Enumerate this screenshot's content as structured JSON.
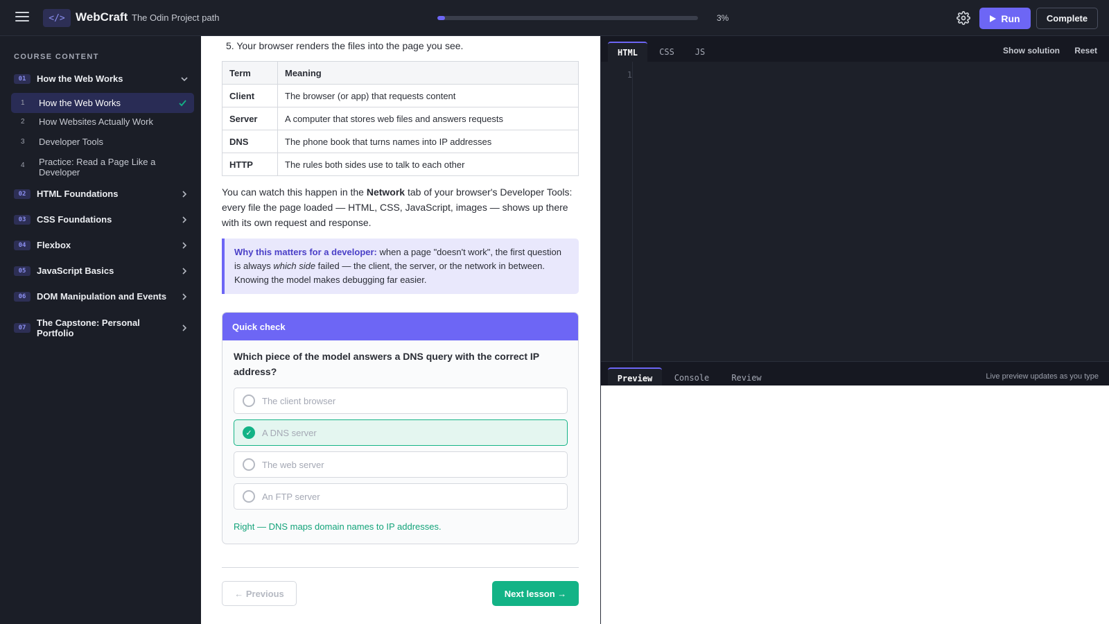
{
  "header": {
    "logo_glyph": "</>",
    "brand": "WebCraft",
    "subtitle": "The Odin Project path",
    "progress_percent": 3,
    "progress_label": "3%",
    "run_label": "Run",
    "complete_label": "Complete"
  },
  "sidebar": {
    "heading": "COURSE CONTENT",
    "modules": [
      {
        "num": "01",
        "title": "How the Web Works",
        "expanded": true
      },
      {
        "num": "02",
        "title": "HTML Foundations",
        "expanded": false
      },
      {
        "num": "03",
        "title": "CSS Foundations",
        "expanded": false
      },
      {
        "num": "04",
        "title": "Flexbox",
        "expanded": false
      },
      {
        "num": "05",
        "title": "JavaScript Basics",
        "expanded": false
      },
      {
        "num": "06",
        "title": "DOM Manipulation and Events",
        "expanded": false
      },
      {
        "num": "07",
        "title": "The Capstone: Personal Portfolio",
        "expanded": false
      }
    ],
    "lessons": [
      {
        "num": "1",
        "title": "How the Web Works",
        "active": true,
        "done": true
      },
      {
        "num": "2",
        "title": "How Websites Actually Work",
        "active": false,
        "done": false
      },
      {
        "num": "3",
        "title": "Developer Tools",
        "active": false,
        "done": false
      },
      {
        "num": "4",
        "title": "Practice: Read a Page Like a Developer",
        "active": false,
        "done": false
      }
    ]
  },
  "lesson": {
    "step5": "5. Your browser renders the files into the page you see.",
    "table": {
      "headers": [
        "Term",
        "Meaning"
      ],
      "rows": [
        [
          "Client",
          "The browser (or app) that requests content"
        ],
        [
          "Server",
          "A computer that stores web files and answers requests"
        ],
        [
          "DNS",
          "The phone book that turns names into IP addresses"
        ],
        [
          "HTTP",
          "The rules both sides use to talk to each other"
        ]
      ]
    },
    "para_pre": "You can watch this happen in the ",
    "para_bold": "Network",
    "para_post": " tab of your browser's Developer Tools: every file the page loaded — HTML, CSS, JavaScript, images — shows up there with its own request and response.",
    "callout_title": "Why this matters for a developer:",
    "callout_text1": " when a page \"doesn't work\", the first question is always ",
    "callout_em": "which side",
    "callout_text2": " failed — the client, the server, or the network in between. Knowing the model makes debugging far easier."
  },
  "quiz": {
    "header": "Quick check",
    "question": "Which piece of the model answers a DNS query with the correct IP address?",
    "options": [
      {
        "label": "The client browser",
        "selected": false
      },
      {
        "label": "A DNS server",
        "selected": true
      },
      {
        "label": "The web server",
        "selected": false
      },
      {
        "label": "An FTP server",
        "selected": false
      }
    ],
    "feedback": "Right — DNS maps domain names to IP addresses.",
    "check_glyph": "✓"
  },
  "nav": {
    "prev_label": "← Previous",
    "next_label": "Next lesson →"
  },
  "editor": {
    "tabs": [
      "HTML",
      "CSS",
      "JS"
    ],
    "active_tab": "HTML",
    "show_solution": "Show solution",
    "reset": "Reset",
    "line_number": "1",
    "preview_tabs": [
      "Preview",
      "Console",
      "Review"
    ],
    "active_preview_tab": "Preview",
    "preview_note": "Live preview updates as you type"
  },
  "colors": {
    "accent": "#6d66f5",
    "success": "#13b386",
    "topbar": "#1d2029",
    "sidebar": "#1b1e27"
  },
  "icons": {
    "menu": "hamburger-icon",
    "settings": "gear-icon",
    "run": "play-icon",
    "expand": "chevron-down-icon",
    "collapsed": "chevron-right-icon",
    "done": "check-icon"
  }
}
